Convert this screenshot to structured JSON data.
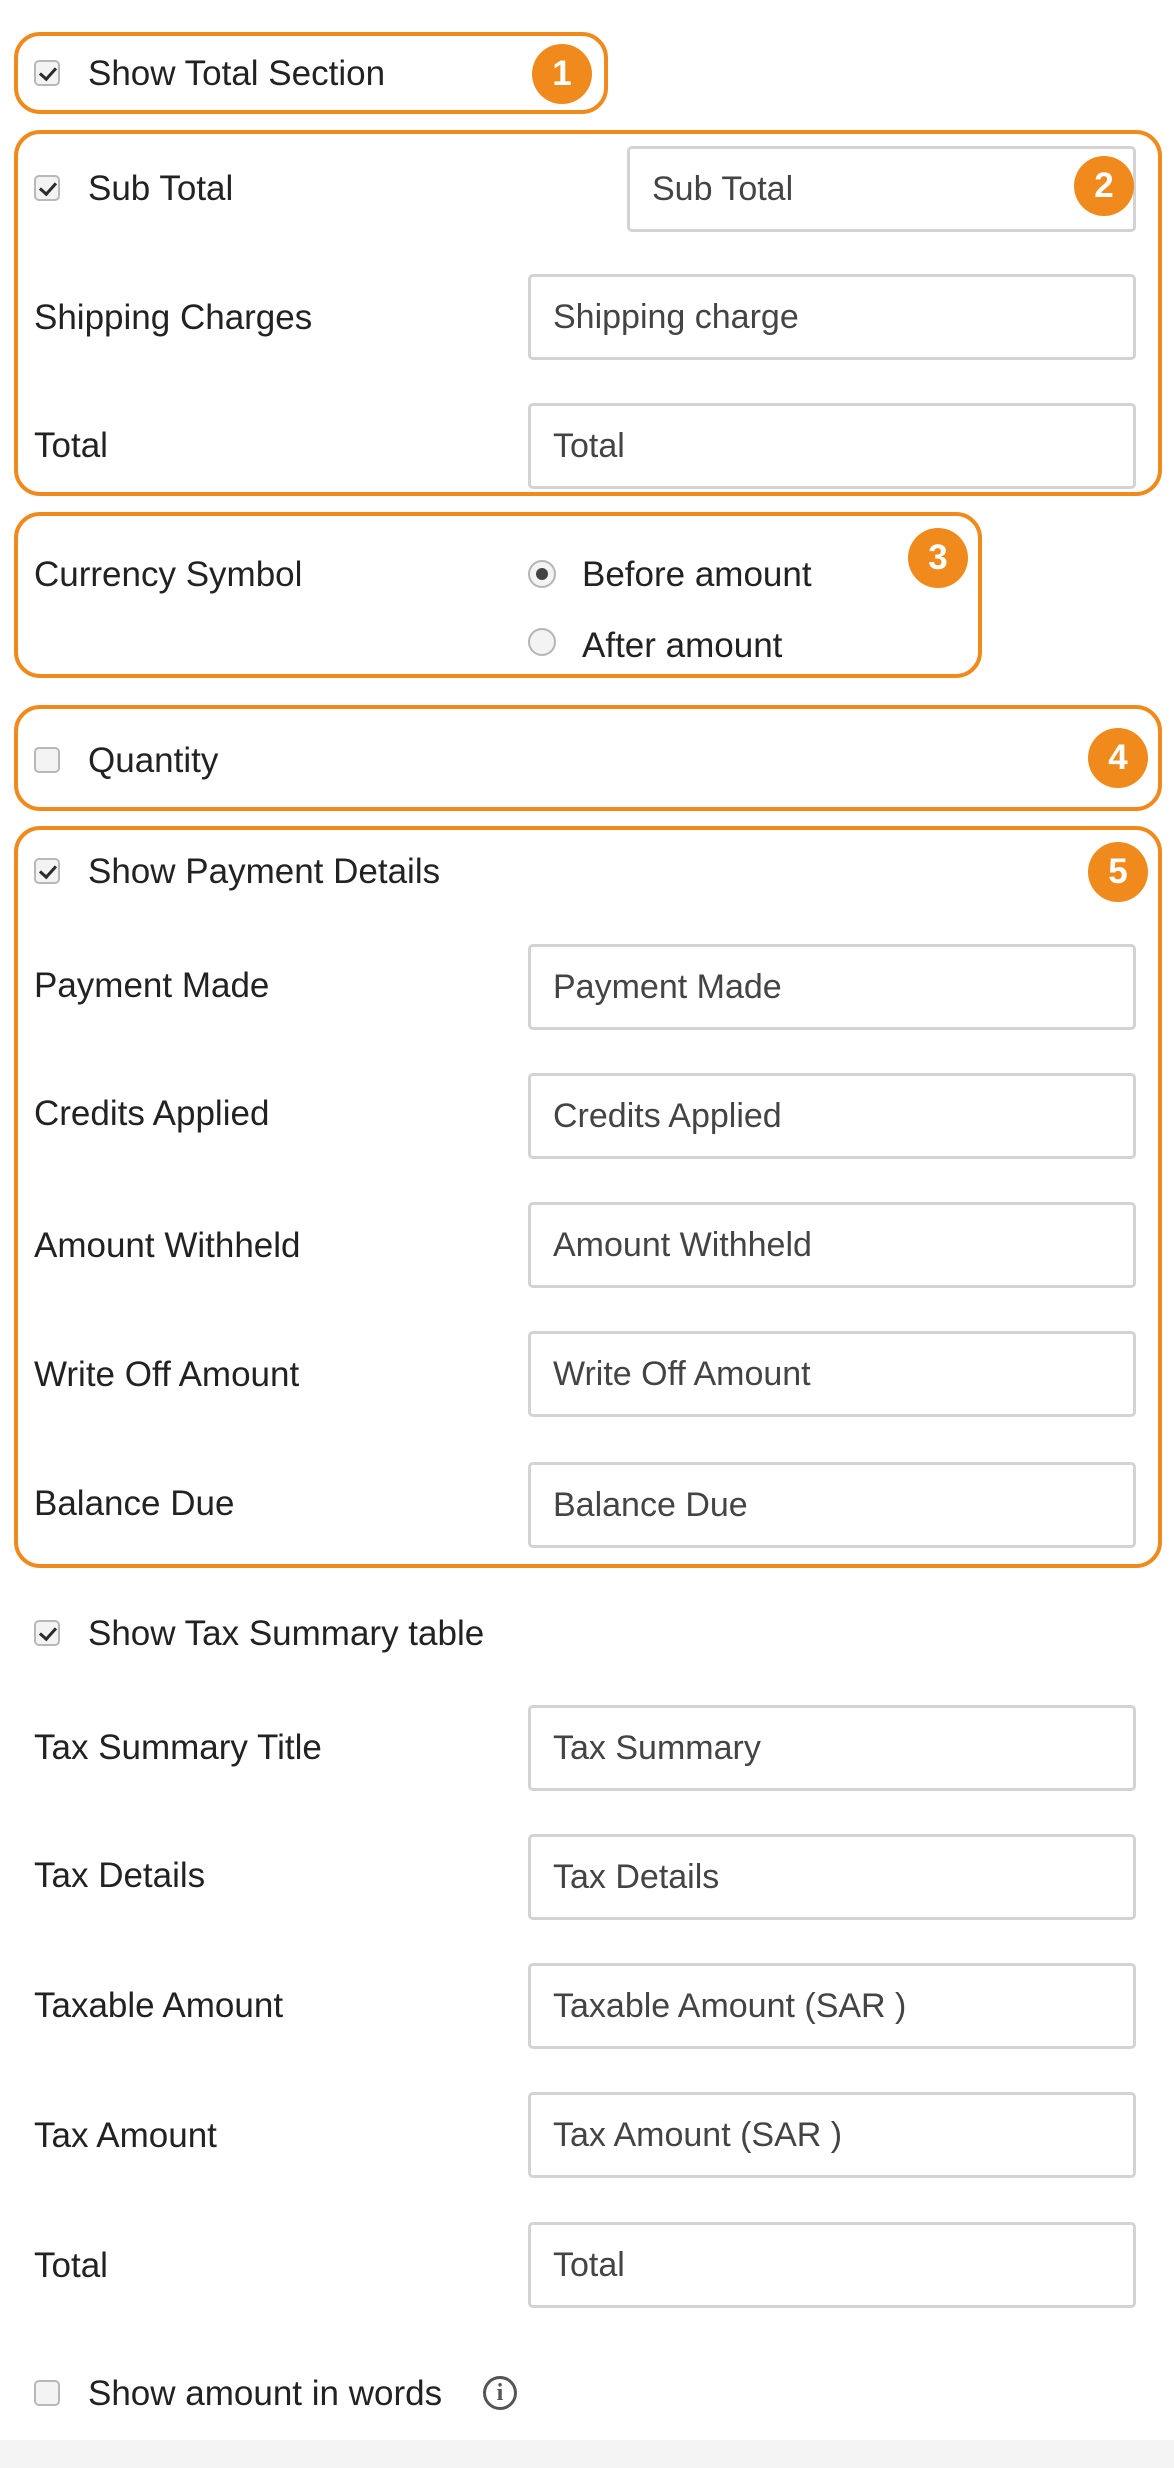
{
  "show_total_section": {
    "label": "Show Total Section",
    "checked": true
  },
  "totals": {
    "sub_total": {
      "label": "Sub Total",
      "checked": true,
      "value": "Sub Total"
    },
    "shipping": {
      "label": "Shipping Charges",
      "value": "Shipping charge"
    },
    "total": {
      "label": "Total",
      "value": "Total"
    }
  },
  "currency_symbol": {
    "label": "Currency Symbol",
    "options": [
      "Before amount",
      "After amount"
    ],
    "selected": "Before amount"
  },
  "quantity": {
    "label": "Quantity",
    "checked": false
  },
  "payment": {
    "label": "Show Payment Details",
    "checked": true,
    "rows": [
      {
        "label": "Payment Made",
        "value": "Payment Made"
      },
      {
        "label": "Credits Applied",
        "value": "Credits Applied"
      },
      {
        "label": "Amount Withheld",
        "value": "Amount Withheld"
      },
      {
        "label": "Write Off Amount",
        "value": "Write Off Amount"
      },
      {
        "label": "Balance Due",
        "value": "Balance Due"
      }
    ]
  },
  "tax_summary": {
    "label": "Show Tax Summary table",
    "checked": true,
    "rows": [
      {
        "label": "Tax Summary Title",
        "value": "Tax Summary"
      },
      {
        "label": "Tax Details",
        "value": "Tax Details"
      },
      {
        "label": "Taxable Amount",
        "value": "Taxable Amount (SAR )"
      },
      {
        "label": "Tax Amount",
        "value": "Tax Amount (SAR )"
      },
      {
        "label": "Total",
        "value": "Total"
      }
    ]
  },
  "amount_in_words": {
    "label": "Show amount in words",
    "checked": false,
    "info_icon": "i"
  },
  "badges": [
    "1",
    "2",
    "3",
    "4",
    "5"
  ],
  "colors": {
    "highlight": "#f08a1c",
    "text": "#222222",
    "field_border": "#d3d3d3"
  }
}
